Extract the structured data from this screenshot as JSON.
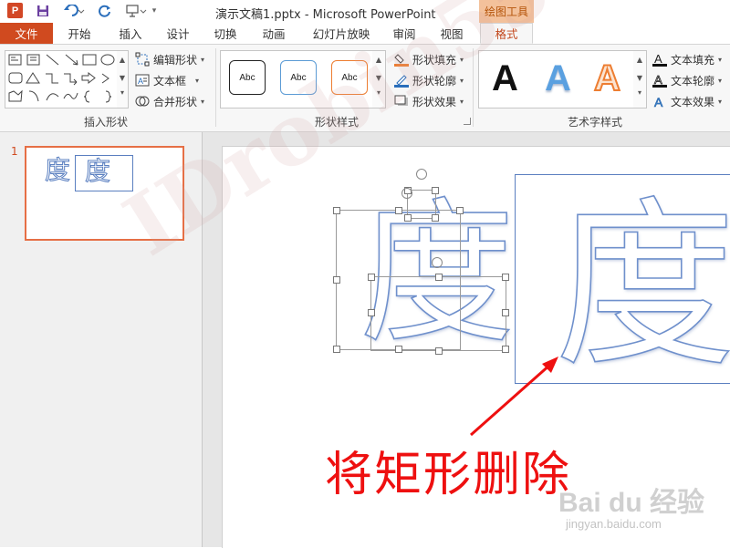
{
  "window": {
    "app_icon_label": "P",
    "title": "演示文稿1.pptx - Microsoft PowerPoint",
    "context_group": "绘图工具"
  },
  "tabs": [
    "文件",
    "开始",
    "插入",
    "设计",
    "切换",
    "动画",
    "幻灯片放映",
    "审阅",
    "视图",
    "格式"
  ],
  "ribbon": {
    "insert_shapes": {
      "label": "插入形状",
      "edit_shape": "编辑形状",
      "text_box": "文本框",
      "merge_shapes": "合并形状",
      "shape_glyphs": [
        "▭",
        "\\",
        "╲",
        "□",
        "○",
        "▢",
        "△",
        "⌐",
        "↳",
        "⇨",
        "⌒",
        "⌓",
        "⌒",
        "{",
        "}",
        "☆"
      ]
    },
    "shape_styles": {
      "label": "形状样式",
      "samples": [
        "Abc",
        "Abc",
        "Abc"
      ],
      "sample_colors": [
        "#222222",
        "#5b9bd5",
        "#ed7d31"
      ],
      "shape_fill": "形状填充",
      "shape_outline": "形状轮廓",
      "shape_effects": "形状效果"
    },
    "wordart_styles": {
      "label": "艺术字样式",
      "samples": [
        "A",
        "A",
        "A"
      ],
      "sample_colors": [
        "#111111",
        "#4a8fd4",
        "#ed7d31"
      ],
      "text_fill": "文本填充",
      "text_outline": "文本轮廓",
      "text_effects": "文本效果"
    }
  },
  "thumbnail": {
    "number": "1",
    "chars": [
      "度",
      "度"
    ]
  },
  "slide": {
    "char_left": "度",
    "char_right": "度",
    "caption": "将矩形删除"
  },
  "watermark": {
    "text": "IDrobin55",
    "baidu_logo": "Bai du 经验",
    "baidu_url": "jingyan.baidu.com"
  },
  "colors": {
    "file_tab": "#d04a1f",
    "accent": "#c2471c",
    "caption_red": "#ee1010",
    "arrow_red": "#ee1010",
    "outline_blue": "#6f90cc",
    "thumb_border": "#e66f45"
  }
}
